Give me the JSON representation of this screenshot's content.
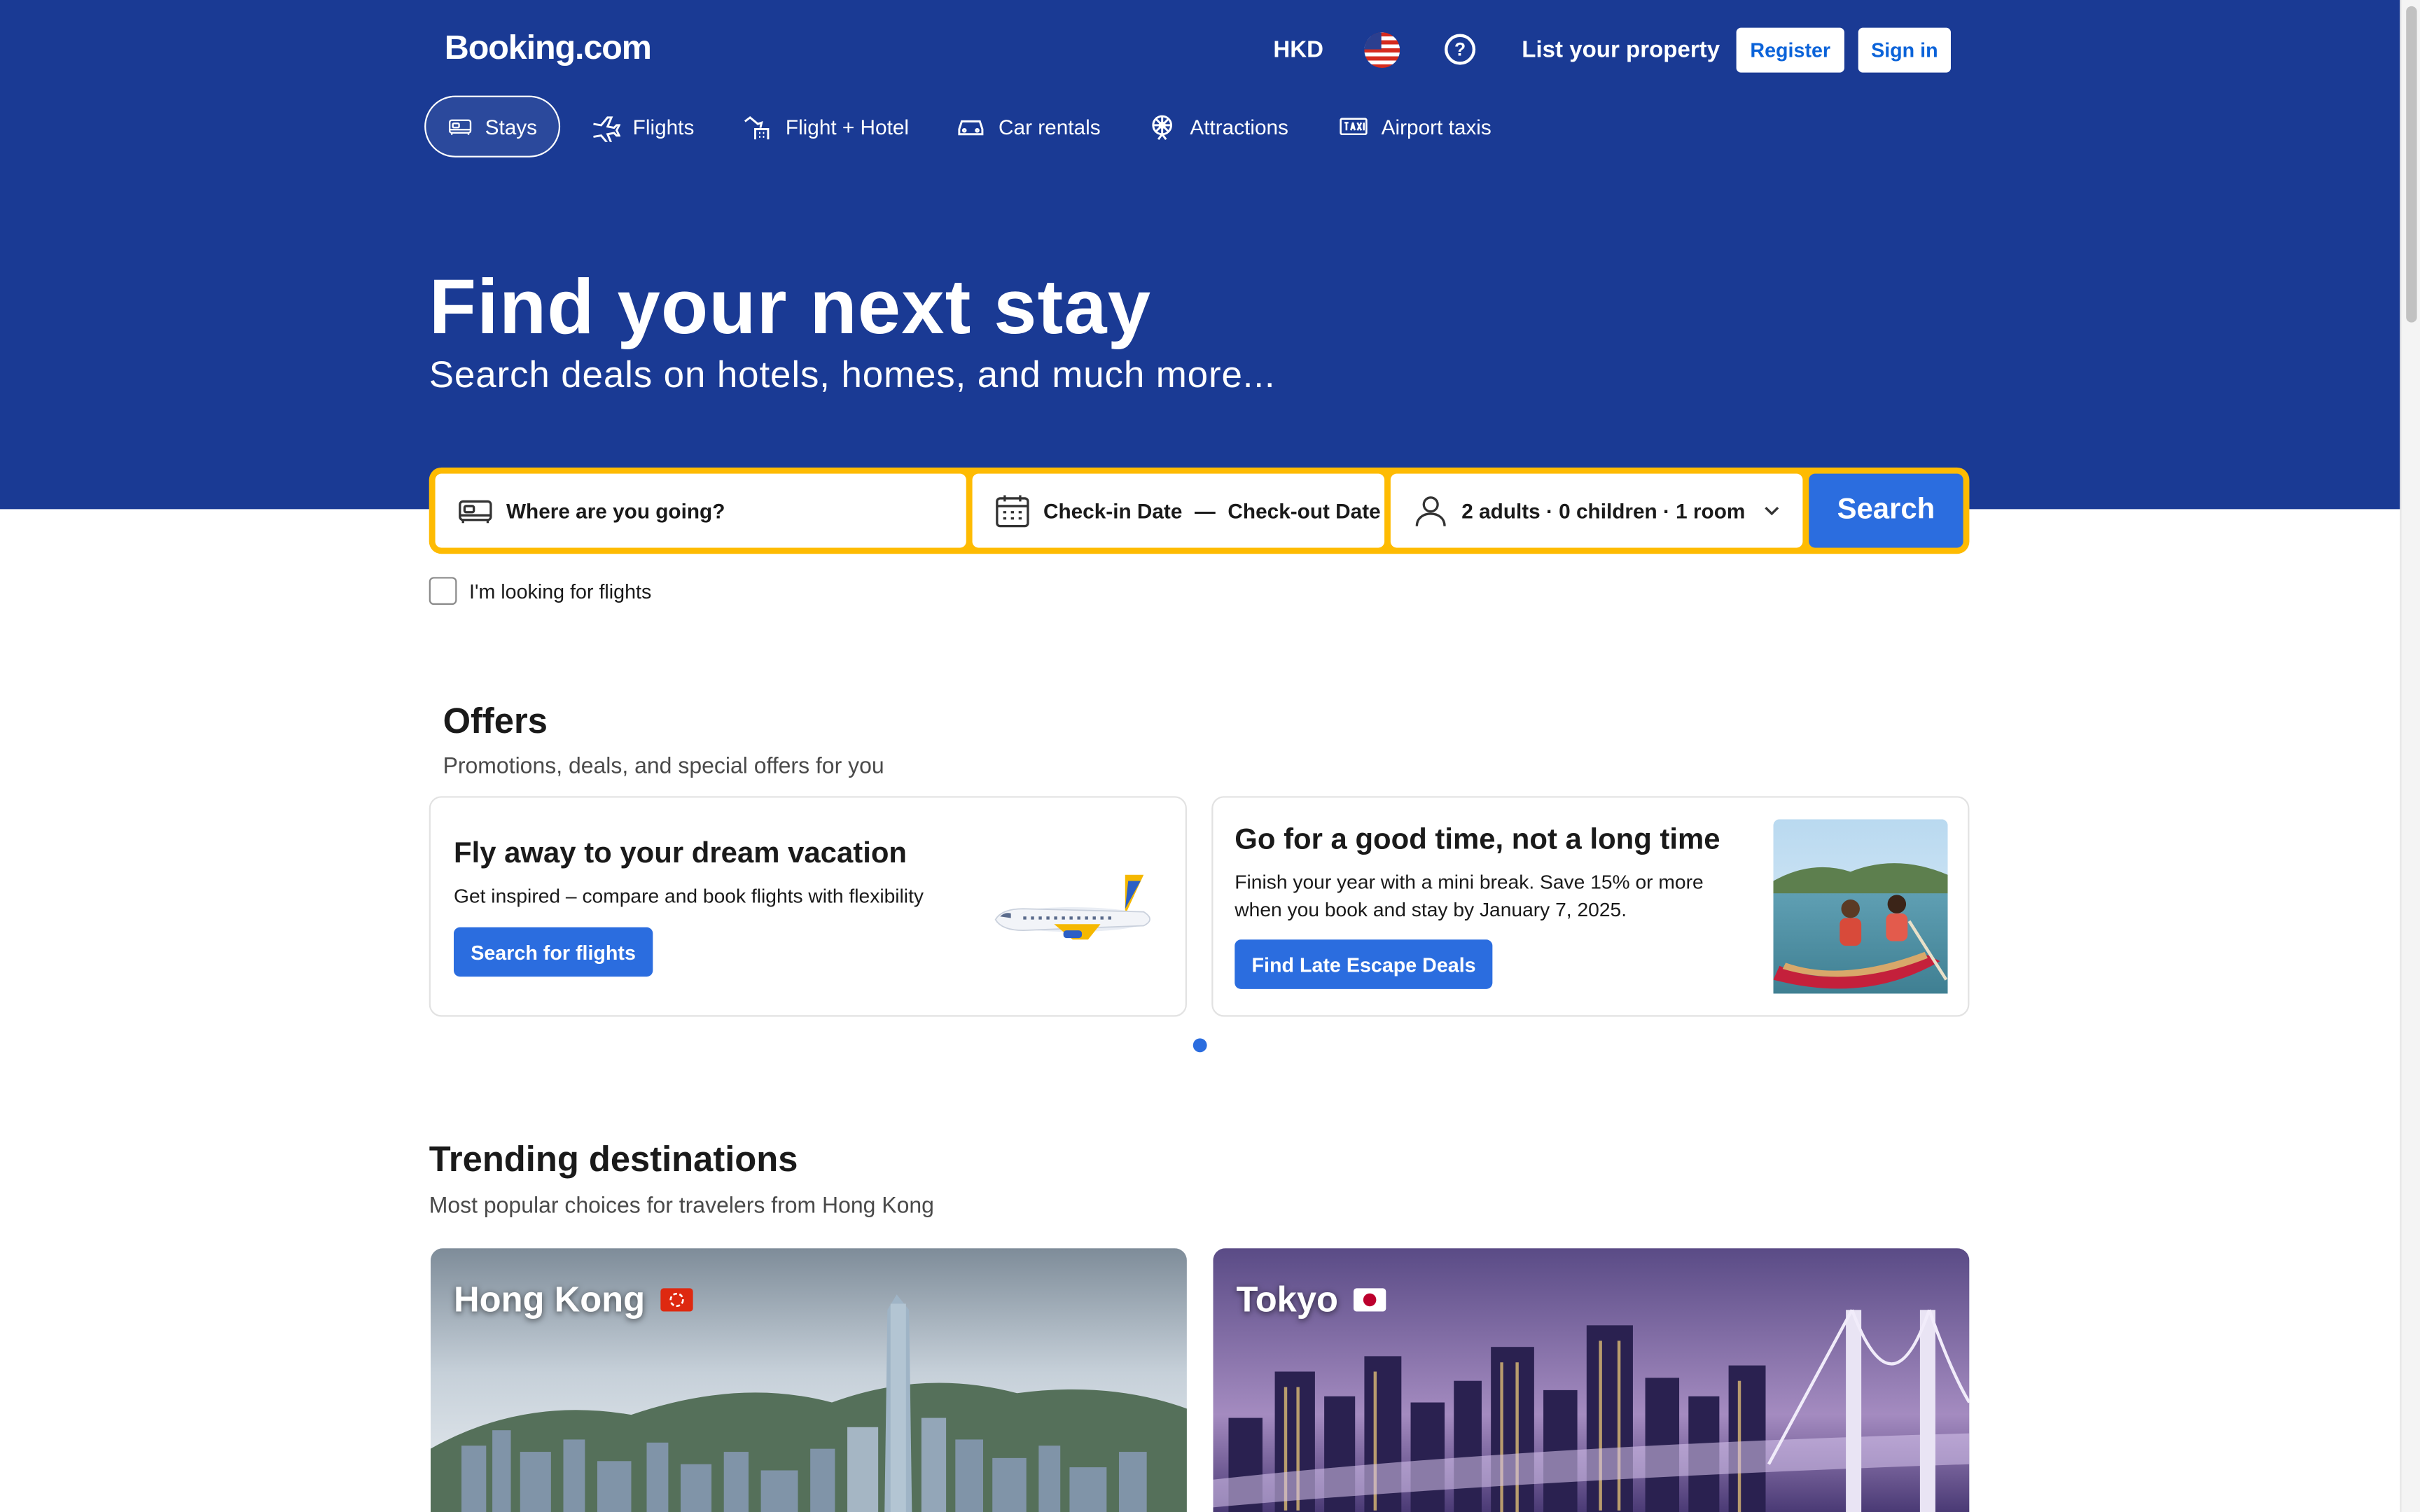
{
  "header": {
    "logo": "Booking.com",
    "currency": "HKD",
    "help_glyph": "?",
    "list_property": "List your property",
    "register": "Register",
    "sign_in": "Sign in"
  },
  "nav": {
    "tabs": [
      {
        "label": "Stays",
        "icon": "bed-icon",
        "active": true
      },
      {
        "label": "Flights",
        "icon": "plane-icon"
      },
      {
        "label": "Flight + Hotel",
        "icon": "flight-hotel-icon"
      },
      {
        "label": "Car rentals",
        "icon": "car-icon"
      },
      {
        "label": "Attractions",
        "icon": "attractions-icon"
      },
      {
        "label": "Airport taxis",
        "icon": "taxi-icon"
      }
    ]
  },
  "hero": {
    "title": "Find your next stay",
    "subtitle": "Search deals on hotels, homes, and much more..."
  },
  "search": {
    "destination_placeholder": "Where are you going?",
    "checkin": "Check-in Date",
    "dash": "—",
    "checkout": "Check-out Date",
    "occupancy": "2 adults · 0 children · 1 room",
    "button": "Search",
    "flights_checkbox": "I'm looking for flights"
  },
  "offers": {
    "title": "Offers",
    "subtitle": "Promotions, deals, and special offers for you",
    "cards": [
      {
        "title": "Fly away to your dream vacation",
        "text": "Get inspired – compare and book flights with flexibility",
        "button": "Search for flights"
      },
      {
        "title": "Go for a good time, not a long time",
        "text_line1": "Finish your year with a mini break. Save 15% or more",
        "text_line2": "when you book and stay by January 7, 2025.",
        "button": "Find Late Escape Deals"
      }
    ]
  },
  "trending": {
    "title": "Trending destinations",
    "subtitle": "Most popular choices for travelers from Hong Kong",
    "destinations": [
      {
        "name": "Hong Kong",
        "flag": "hong-kong-flag"
      },
      {
        "name": "Tokyo",
        "flag": "japan-flag"
      }
    ]
  },
  "colors": {
    "brand_blue": "#1a3a94",
    "accent_blue": "#2b6ddf",
    "search_border": "#febb02"
  }
}
